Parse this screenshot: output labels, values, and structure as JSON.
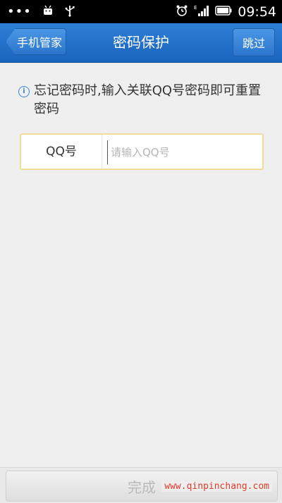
{
  "status_bar": {
    "dots": "•••",
    "time": "09:54"
  },
  "header": {
    "back_label": "手机管家",
    "title": "密码保护",
    "skip_label": "跳过"
  },
  "hint": {
    "icon": "info-icon",
    "text": "忘记密码时,输入关联QQ号密码即可重置密码"
  },
  "form": {
    "qq_label": "QQ号",
    "qq_placeholder": "请输入QQ号",
    "qq_value": ""
  },
  "footer": {
    "done_label": "完成"
  },
  "watermark": "www.qinpinchang.com",
  "colors": {
    "header": "#1f6cc6",
    "input_border": "#f1dd97",
    "watermark": "#e23b2b"
  }
}
